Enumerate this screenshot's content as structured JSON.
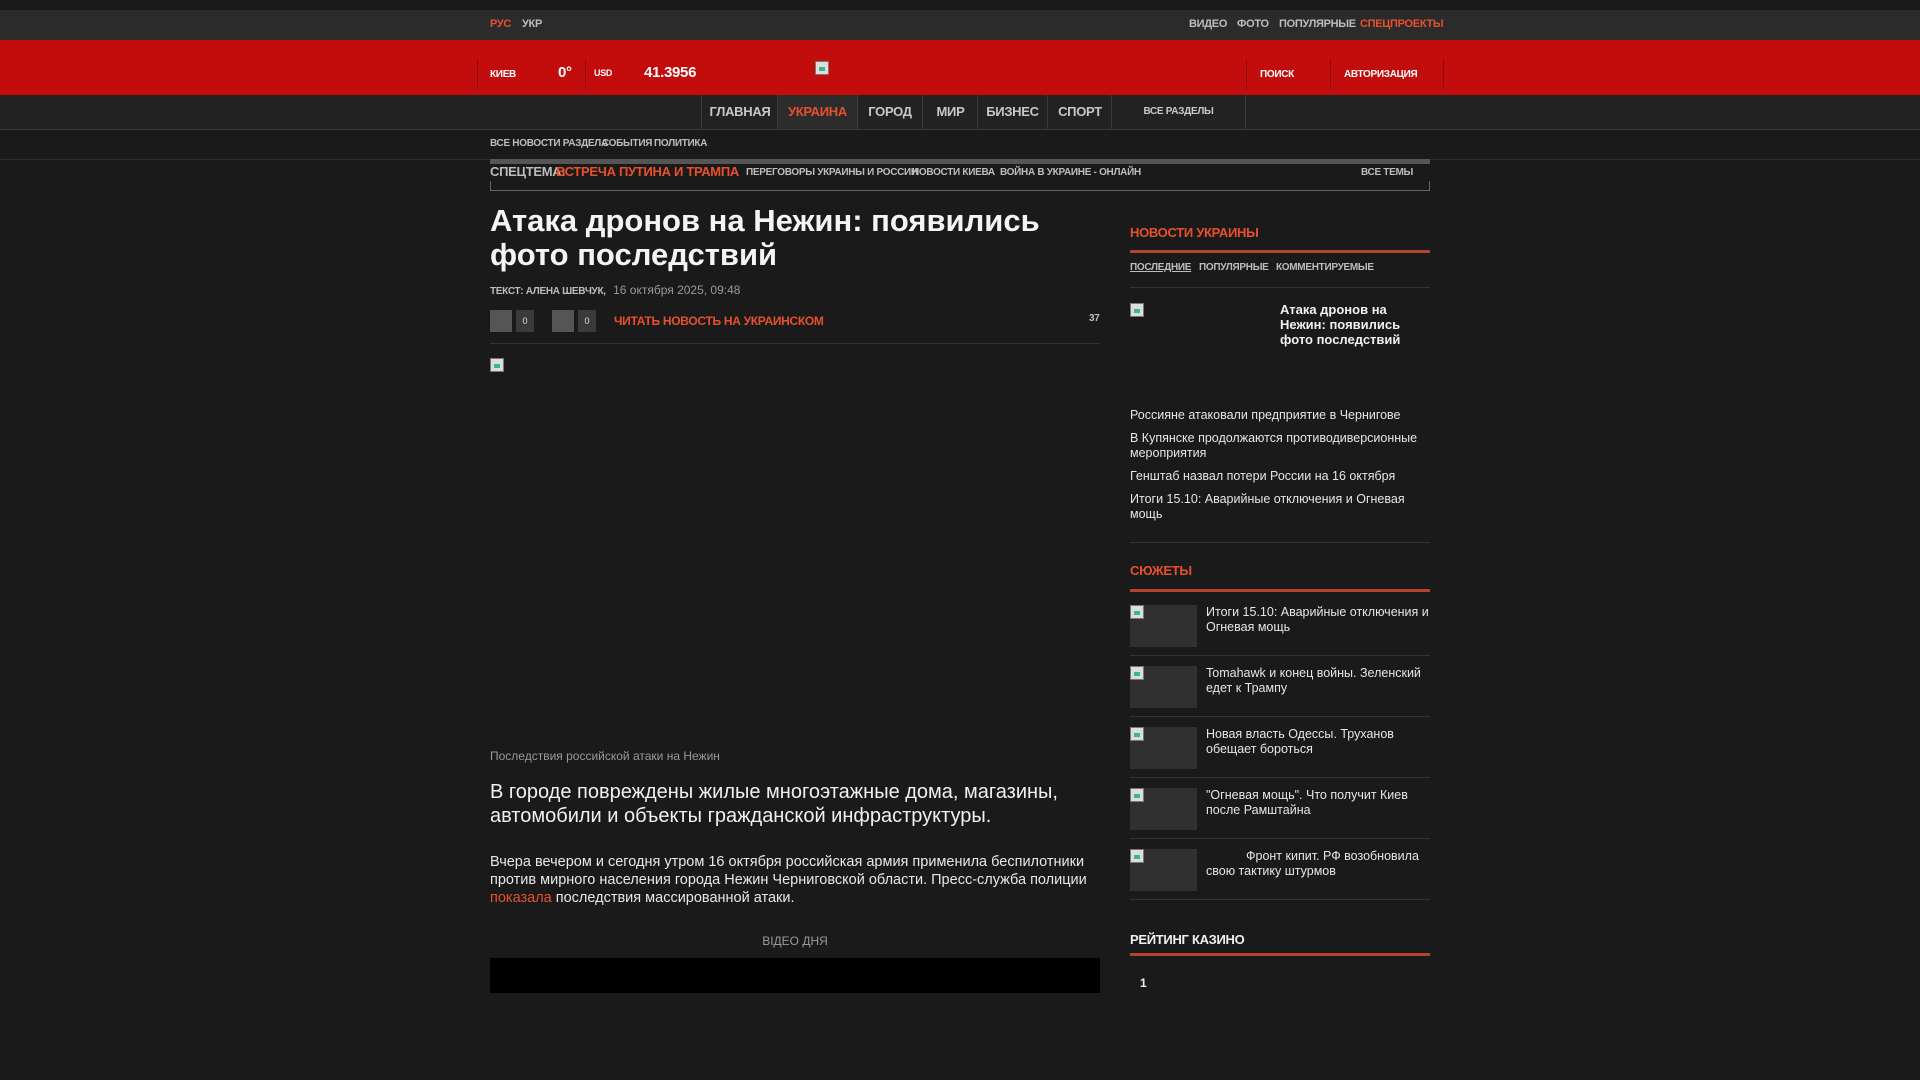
{
  "topbar": {
    "lang_ru": "РУС",
    "lang_uk": "УКР",
    "links": [
      "ВИДЕО",
      "ФОТО",
      "ПОПУЛЯРНЫЕ",
      "СПЕЦПРОЕКТЫ"
    ]
  },
  "header": {
    "city": "КИЕВ",
    "temperature": "0°",
    "currency": "USD",
    "rate": "41.3956",
    "search": "ПОИСК",
    "auth": "АВТОРИЗАЦИЯ"
  },
  "mainnav": {
    "items": [
      "ГЛАВНАЯ",
      "УКРАИНА",
      "ГОРОД",
      "МИР",
      "БИЗНЕС",
      "СПОРТ"
    ],
    "all_sections": "ВСЕ РАЗДЕЛЫ"
  },
  "subnav": {
    "items": [
      "ВСЕ НОВОСТИ РАЗДЕЛА",
      "СОБЫТИЯ",
      "ПОЛИТИКА"
    ]
  },
  "theme": {
    "label": "СПЕЦТЕМА:",
    "highlight": "ВСТРЕЧА ПУТИНА И ТРАМПА",
    "links": [
      "ПЕРЕГОВОРЫ УКРАИНЫ И РОССИИ",
      "НОВОСТИ КИЕВА",
      "ВОЙНА В УКРАИНЕ - ОНЛАЙН"
    ],
    "all": "ВСЕ ТЕМЫ"
  },
  "article": {
    "title": "Атака дронов на Нежин: появились фото последствий",
    "author": "ТЕКСТ: АЛЕНА ШЕВЧУК,",
    "date": "16 октября 2025, 09:48",
    "share_count_1": "0",
    "share_count_2": "0",
    "read_ukrainian": "ЧИТАТЬ НОВОСТЬ НА УКРАИНСКОМ",
    "comments": "37",
    "caption": "Последствия российской атаки на Нежин",
    "lead": "В городе повреждены жилые многоэтажные дома, магазины, автомобили и объекты гражданской инфраструктуры.",
    "body_before": "Вчера вечером и сегодня утром 16 октября российская армия применила беспилотники против мирного населения города Нежин Черниговской области. Пресс-служба полиции ",
    "body_link": "показала",
    "body_after": " последствия массированной атаки.",
    "video_label": "ВІДЕО ДНЯ"
  },
  "sidebar": {
    "news_heading": "НОВОСТИ УКРАИНЫ",
    "tabs": [
      "ПОСЛЕДНИЕ",
      "ПОПУЛЯРНЫЕ",
      "КОММЕНТИРУЕМЫЕ"
    ],
    "featured": "Атака дронов на Нежин: появились фото последствий",
    "news": [
      "Россияне атаковали предприятие в Чернигове",
      "В Купянске продолжаются противодиверсионные мероприятия",
      "Генштаб назвал потери России на 16 октября",
      "Итоги 15.10: Аварийные отключения и Огневая мощь"
    ],
    "stories_heading": "СЮЖЕТЫ",
    "stories": [
      "Итоги 15.10: Аварийные отключения и Огневая мощь",
      "Tomahawk и конец войны. Зеленский едет к Трампу",
      "Новая власть Одессы. Труханов обещает бороться",
      "\"Огневая мощь\". Что получит Киев после Рамштайна",
      "Фронт кипит. РФ возобновила свою тактику штурмов"
    ],
    "casino_heading": "РЕЙТИНГ КАЗИНО",
    "casino_first": "1"
  }
}
